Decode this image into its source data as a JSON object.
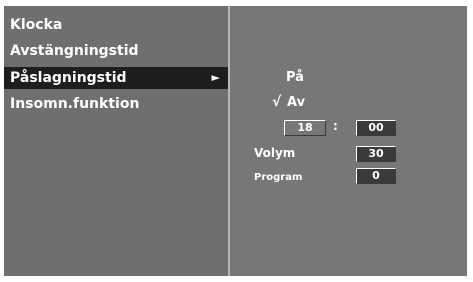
{
  "menu": {
    "items": [
      {
        "label": "Klocka"
      },
      {
        "label": "Avstängningstid"
      },
      {
        "label": "Påslagningstid",
        "arrow": "►"
      },
      {
        "label": "Insomn.funktion"
      }
    ]
  },
  "settings": {
    "option_on": "På",
    "check_mark": "√",
    "option_off": "Av",
    "hour": "18",
    "separator": ":",
    "minute": "00",
    "volume_label": "Volym",
    "volume_value": "30",
    "program_label": "Program",
    "program_value": "0"
  }
}
